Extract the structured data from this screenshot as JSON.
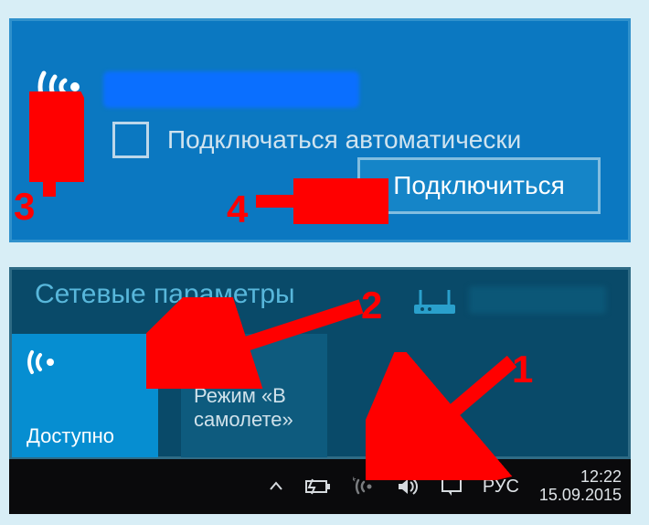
{
  "network_popup": {
    "ssid_hidden": true,
    "auto_connect_label": "Подключаться автоматически",
    "auto_connect_checked": false,
    "connect_button": "Подключиться"
  },
  "network_settings": {
    "title": "Сетевые параметры",
    "wifi_tile": {
      "status": "Доступно"
    },
    "airplane_tile": {
      "label": "Режим «В самолете»"
    },
    "router_label_hidden": true
  },
  "taskbar": {
    "language": "РУС",
    "time": "12:22",
    "date": "15.09.2015"
  },
  "annotations": {
    "step1": "1",
    "step2": "2",
    "step3": "3",
    "step4": "4"
  },
  "icons": {
    "wifi": "wifi-icon",
    "airplane": "airplane-icon",
    "router": "router-icon",
    "chevron_up": "chevron-up-icon",
    "battery": "battery-icon",
    "volume": "volume-icon",
    "action_center": "action-center-icon"
  }
}
